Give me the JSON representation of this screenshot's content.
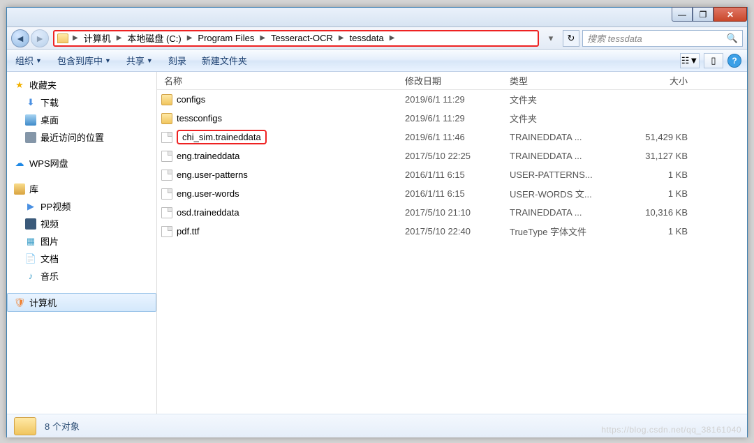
{
  "titlebar": {
    "min": "—",
    "max": "❐",
    "close": "✕"
  },
  "breadcrumb": [
    {
      "label": "计算机"
    },
    {
      "label": "本地磁盘 (C:)"
    },
    {
      "label": "Program Files"
    },
    {
      "label": "Tesseract-OCR"
    },
    {
      "label": "tessdata"
    }
  ],
  "search": {
    "placeholder": "搜索 tessdata"
  },
  "toolbar": {
    "organize": "组织",
    "include": "包含到库中",
    "share": "共享",
    "burn": "刻录",
    "newfolder": "新建文件夹",
    "help": "?"
  },
  "sidebar": {
    "favorites": {
      "label": "收藏夹",
      "items": [
        {
          "label": "下载",
          "icon": "ic-dl"
        },
        {
          "label": "桌面",
          "icon": "ic-desktop"
        },
        {
          "label": "最近访问的位置",
          "icon": "ic-recent"
        }
      ]
    },
    "wps": {
      "label": "WPS网盘",
      "icon": "ic-wps"
    },
    "library": {
      "label": "库",
      "items": [
        {
          "label": "PP视频",
          "icon": "ic-pp"
        },
        {
          "label": "视频",
          "icon": "ic-video"
        },
        {
          "label": "图片",
          "icon": "ic-img"
        },
        {
          "label": "文档",
          "icon": "ic-doc"
        },
        {
          "label": "音乐",
          "icon": "ic-music"
        }
      ]
    },
    "computer": {
      "label": "计算机",
      "icon": "ic-computer"
    }
  },
  "columns": {
    "name": "名称",
    "date": "修改日期",
    "type": "类型",
    "size": "大小"
  },
  "files": [
    {
      "name": "configs",
      "date": "2019/6/1 11:29",
      "type": "文件夹",
      "size": "",
      "kind": "folder",
      "hl": false
    },
    {
      "name": "tessconfigs",
      "date": "2019/6/1 11:29",
      "type": "文件夹",
      "size": "",
      "kind": "folder",
      "hl": false
    },
    {
      "name": "chi_sim.traineddata",
      "date": "2019/6/1 11:46",
      "type": "TRAINEDDATA ...",
      "size": "51,429 KB",
      "kind": "file",
      "hl": true
    },
    {
      "name": "eng.traineddata",
      "date": "2017/5/10 22:25",
      "type": "TRAINEDDATA ...",
      "size": "31,127 KB",
      "kind": "file",
      "hl": false
    },
    {
      "name": "eng.user-patterns",
      "date": "2016/1/11 6:15",
      "type": "USER-PATTERNS...",
      "size": "1 KB",
      "kind": "file",
      "hl": false
    },
    {
      "name": "eng.user-words",
      "date": "2016/1/11 6:15",
      "type": "USER-WORDS 文...",
      "size": "1 KB",
      "kind": "file",
      "hl": false
    },
    {
      "name": "osd.traineddata",
      "date": "2017/5/10 21:10",
      "type": "TRAINEDDATA ...",
      "size": "10,316 KB",
      "kind": "file",
      "hl": false
    },
    {
      "name": "pdf.ttf",
      "date": "2017/5/10 22:40",
      "type": "TrueType 字体文件",
      "size": "1 KB",
      "kind": "file",
      "hl": false
    }
  ],
  "status": {
    "count": "8 个对象"
  },
  "watermark": "https://blog.csdn.net/qq_38161040"
}
